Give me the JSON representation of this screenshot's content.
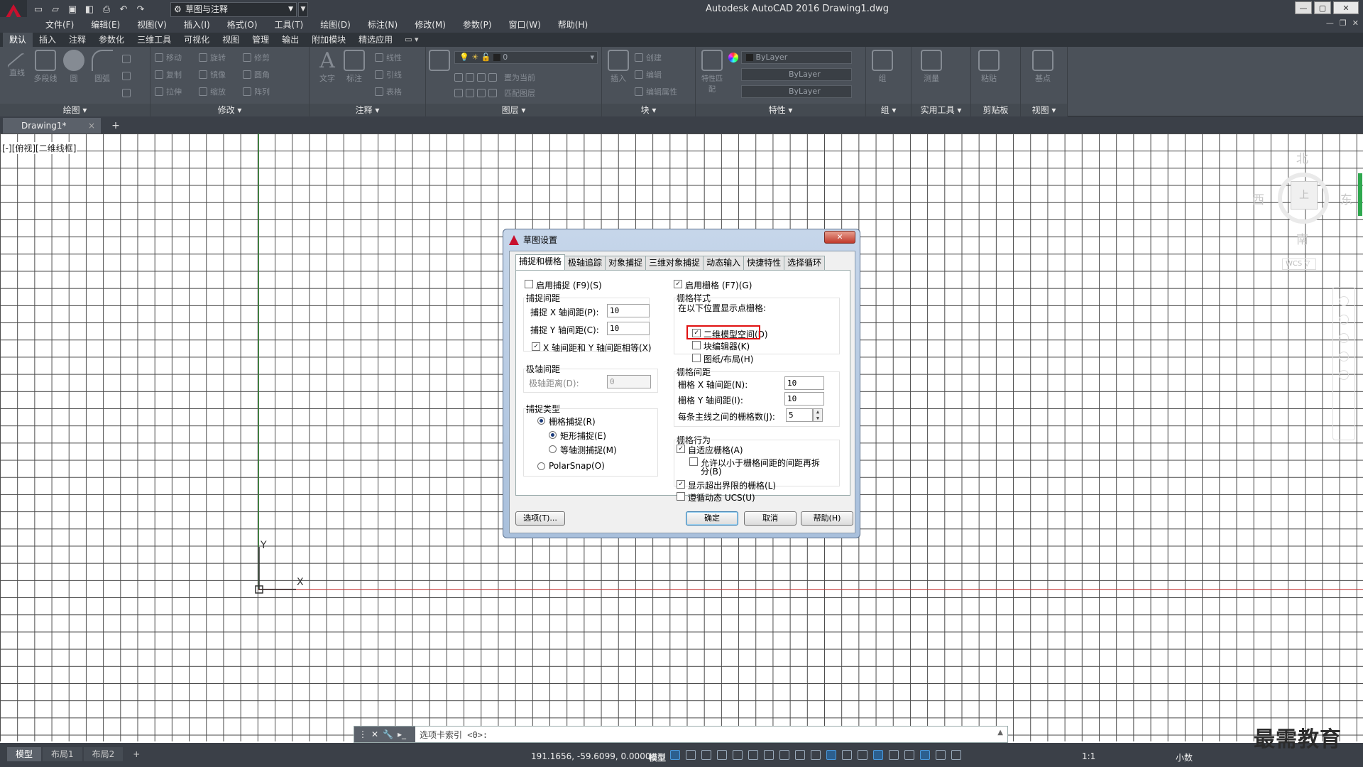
{
  "titlebar": {
    "workspace": "草图与注释",
    "window_title": "Autodesk AutoCAD 2016    Drawing1.dwg",
    "restore_label": "▢",
    "close_label": "✕",
    "min_label": "—"
  },
  "menu": {
    "items": [
      "文件(F)",
      "编辑(E)",
      "视图(V)",
      "插入(I)",
      "格式(O)",
      "工具(T)",
      "绘图(D)",
      "标注(N)",
      "修改(M)",
      "参数(P)",
      "窗口(W)",
      "帮助(H)"
    ]
  },
  "ribbon": {
    "tabs": [
      "默认",
      "插入",
      "注释",
      "参数化",
      "三维工具",
      "可视化",
      "视图",
      "管理",
      "输出",
      "附加模块",
      "精选应用"
    ],
    "panels": {
      "draw": "绘图 ▾",
      "modify": "修改 ▾",
      "annotate": "注释 ▾",
      "layers": "图层 ▾",
      "block": "块 ▾",
      "properties": "特性 ▾",
      "groups": "组 ▾",
      "utilities": "实用工具 ▾",
      "clipboard": "剪贴板",
      "view": "视图 ▾"
    },
    "draw_buttons": [
      "直线",
      "多段线",
      "圆",
      "圆弧"
    ],
    "modify_rows": [
      "移动",
      "旋转",
      "修剪",
      "复制",
      "镜像",
      "圆角",
      "拉伸",
      "缩放",
      "阵列"
    ],
    "annotate_buttons": [
      "文字",
      "标注"
    ],
    "annotate_rows": [
      "线性",
      "引线",
      "表格"
    ],
    "layer_value": "0",
    "layer_rows": [
      "置为当前",
      "匹配图层"
    ],
    "block_buttons": [
      "插入"
    ],
    "block_rows": [
      "创建",
      "编辑",
      "编辑属性"
    ],
    "properties_button": "特性匹配",
    "property_combos": [
      "ByLayer",
      "ByLayer",
      "ByLayer"
    ],
    "groups_button": "组",
    "utilities_button": "测量",
    "clipboard_button": "粘贴",
    "view_button": "基点"
  },
  "filetabs": {
    "active": "Drawing1*",
    "close": "×",
    "new": "+"
  },
  "viewport": {
    "label": "[-][俯视][二维线框]",
    "ucs_x": "X",
    "ucs_y": "Y"
  },
  "viewcube": {
    "north": "北",
    "south": "南",
    "east": "东",
    "west": "西",
    "face": "上",
    "wcs": "WCS ▽"
  },
  "dialog": {
    "title": "草图设置",
    "close": "✕",
    "tabs": [
      "捕捉和栅格",
      "极轴追踪",
      "对象捕捉",
      "三维对象捕捉",
      "动态输入",
      "快捷特性",
      "选择循环"
    ],
    "enable_snap": "启用捕捉 (F9)(S)",
    "snap_spacing": "捕捉间距",
    "snap_x_label": "捕捉 X 轴间距(P):",
    "snap_x_value": "10",
    "snap_y_label": "捕捉 Y 轴间距(C):",
    "snap_y_value": "10",
    "equal_xy": "X 轴间距和 Y 轴间距相等(X)",
    "polar_spacing": "极轴间距",
    "polar_distance_label": "极轴距离(D):",
    "polar_distance_value": "0",
    "snap_type": "捕捉类型",
    "grid_snap": "栅格捕捉(R)",
    "rect_snap": "矩形捕捉(E)",
    "iso_snap": "等轴测捕捉(M)",
    "polar_snap": "PolarSnap(O)",
    "enable_grid": "启用栅格 (F7)(G)",
    "grid_style": "栅格样式",
    "grid_style_desc": "在以下位置显示点栅格:",
    "model_space_2d": "二维模型空间(D)",
    "block_editor": "块编辑器(K)",
    "sheet_layout": "图纸/布局(H)",
    "grid_spacing": "栅格间距",
    "grid_x_label": "栅格 X 轴间距(N):",
    "grid_x_value": "10",
    "grid_y_label": "栅格 Y 轴间距(I):",
    "grid_y_value": "10",
    "major_line_label": "每条主线之间的栅格数(J):",
    "major_line_value": "5",
    "grid_behavior": "栅格行为",
    "adaptive_grid": "自适应栅格(A)",
    "allow_subdivision_1": "允许以小于栅格间距的间距再拆",
    "allow_subdivision_2": "分(B)",
    "display_beyond": "显示超出界限的栅格(L)",
    "follow_ucs": "遵循动态 UCS(U)",
    "options_btn": "选项(T)...",
    "ok_btn": "确定",
    "cancel_btn": "取消",
    "help_btn": "帮助(H)"
  },
  "cmdline": {
    "prompt": "选项卡索引 <0>:",
    "arrow": "▲"
  },
  "status": {
    "layout_tabs": [
      "模型",
      "布局1",
      "布局2"
    ],
    "add_layout": "+",
    "coords": "191.1656, -59.6099, 0.0000",
    "model": "模型",
    "scale": "1:1",
    "units": "小数"
  },
  "watermark": "最需教育",
  "colors": {
    "accent": "#2c5f8e",
    "ui_dark": "#3b4048",
    "highlight": "#e01010",
    "y_axis": "#2a8a2a",
    "x_axis": "#c03030"
  }
}
